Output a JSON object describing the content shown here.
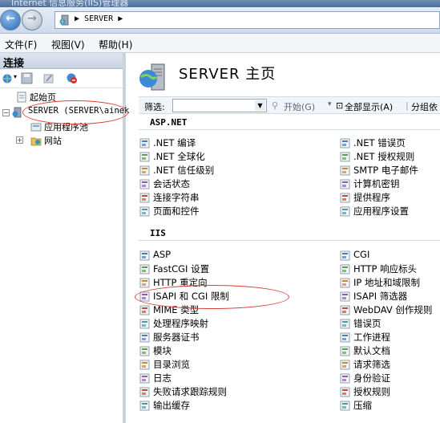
{
  "window": {
    "title": "Internet 信息服务(IIS)管理器"
  },
  "address": {
    "path": "SERVER",
    "separator_before": "▶",
    "separator_after": "▶"
  },
  "menu": [
    {
      "label": "文件(F)",
      "name": "menu-file"
    },
    {
      "label": "视图(V)",
      "name": "menu-view"
    },
    {
      "label": "帮助(H)",
      "name": "menu-help"
    }
  ],
  "connections": {
    "header": "连接",
    "tree": [
      {
        "label": "起始页",
        "name": "tree-start-page"
      },
      {
        "label": "SERVER (SERVER\\aineke",
        "name": "tree-server"
      },
      {
        "label": "应用程序池",
        "name": "tree-app-pools"
      },
      {
        "label": "网站",
        "name": "tree-sites"
      }
    ]
  },
  "page": {
    "title": "SERVER 主页"
  },
  "filter": {
    "label": "筛选:",
    "value": "",
    "start_label": "开始(G)",
    "show_all_label": "全部显示(A)",
    "group_label": "分组依"
  },
  "sections": [
    {
      "title": "ASP.NET",
      "left": [
        {
          "label": ".NET 编译",
          "icon": "dotnet-compile-icon"
        },
        {
          "label": ".NET 全球化",
          "icon": "globe-icon"
        },
        {
          "label": ".NET 信任级别",
          "icon": "trust-level-icon"
        },
        {
          "label": "会话状态",
          "icon": "session-state-icon"
        },
        {
          "label": "连接字符串",
          "icon": "connection-string-icon"
        },
        {
          "label": "页面和控件",
          "icon": "pages-controls-icon"
        }
      ],
      "right": [
        {
          "label": ".NET 错误页",
          "icon": "error-page-icon"
        },
        {
          "label": ".NET 授权规则",
          "icon": "authorization-icon"
        },
        {
          "label": "SMTP 电子邮件",
          "icon": "smtp-icon"
        },
        {
          "label": "计算机密钥",
          "icon": "machine-key-icon"
        },
        {
          "label": "提供程序",
          "icon": "providers-icon"
        },
        {
          "label": "应用程序设置",
          "icon": "app-settings-icon"
        }
      ]
    },
    {
      "title": "IIS",
      "left": [
        {
          "label": "ASP",
          "icon": "asp-icon"
        },
        {
          "label": "FastCGI 设置",
          "icon": "fastcgi-icon"
        },
        {
          "label": "HTTP 重定向",
          "icon": "http-redirect-icon"
        },
        {
          "label": "ISAPI 和 CGI 限制",
          "icon": "isapi-cgi-restrictions-icon"
        },
        {
          "label": "MIME 类型",
          "icon": "mime-types-icon"
        },
        {
          "label": "处理程序映射",
          "icon": "handler-mappings-icon"
        },
        {
          "label": "服务器证书",
          "icon": "server-certificates-icon"
        },
        {
          "label": "模块",
          "icon": "modules-icon"
        },
        {
          "label": "目录浏览",
          "icon": "directory-browsing-icon"
        },
        {
          "label": "日志",
          "icon": "logging-icon"
        },
        {
          "label": "失败请求跟踪规则",
          "icon": "failed-request-tracing-icon"
        },
        {
          "label": "输出缓存",
          "icon": "output-caching-icon"
        }
      ],
      "right": [
        {
          "label": "CGI",
          "icon": "cgi-icon"
        },
        {
          "label": "HTTP 响应标头",
          "icon": "http-response-headers-icon"
        },
        {
          "label": "IP 地址和域限制",
          "icon": "ip-domain-restrictions-icon"
        },
        {
          "label": "ISAPI 筛选器",
          "icon": "isapi-filters-icon"
        },
        {
          "label": "WebDAV 创作规则",
          "icon": "webdav-icon"
        },
        {
          "label": "错误页",
          "icon": "error-pages-icon"
        },
        {
          "label": "工作进程",
          "icon": "worker-processes-icon"
        },
        {
          "label": "默认文档",
          "icon": "default-document-icon"
        },
        {
          "label": "请求筛选",
          "icon": "request-filtering-icon"
        },
        {
          "label": "身份验证",
          "icon": "authentication-icon"
        },
        {
          "label": "授权规则",
          "icon": "authorization-rules-icon"
        },
        {
          "label": "压缩",
          "icon": "compression-icon"
        }
      ]
    }
  ]
}
